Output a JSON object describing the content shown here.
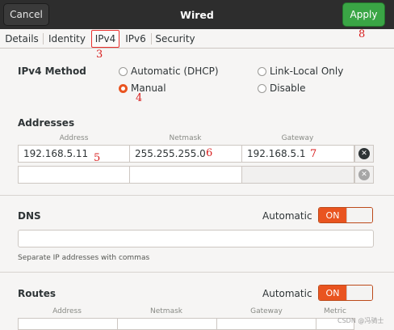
{
  "window": {
    "title": "Wired",
    "cancel_label": "Cancel",
    "apply_label": "Apply"
  },
  "tabs": [
    "Details",
    "Identity",
    "IPv4",
    "IPv6",
    "Security"
  ],
  "annotations": [
    "3",
    "4",
    "5",
    "6",
    "7",
    "8"
  ],
  "ipv4": {
    "method_label": "IPv4 Method",
    "options": {
      "dhcp": "Automatic (DHCP)",
      "link_local": "Link-Local Only",
      "manual": "Manual",
      "disable": "Disable"
    },
    "selected": "Manual"
  },
  "addresses": {
    "title": "Addresses",
    "columns": [
      "Address",
      "Netmask",
      "Gateway"
    ],
    "rows": [
      {
        "address": "192.168.5.11",
        "netmask": "255.255.255.0",
        "gateway": "192.168.5.1"
      },
      {
        "address": "",
        "netmask": "",
        "gateway": ""
      }
    ]
  },
  "dns": {
    "title": "DNS",
    "automatic_label": "Automatic",
    "toggle": "ON",
    "value": "",
    "hint": "Separate IP addresses with commas"
  },
  "routes": {
    "title": "Routes",
    "automatic_label": "Automatic",
    "toggle": "ON",
    "columns": [
      "Address",
      "Netmask",
      "Gateway",
      "Metric"
    ]
  },
  "watermark": "CSDN @冯骑士",
  "colors": {
    "accent": "#e95420",
    "apply": "#3aa545",
    "header": "#2d2d2d",
    "annotation": "#d81e1e"
  },
  "icons": [
    "radio-icon",
    "clear-icon"
  ]
}
